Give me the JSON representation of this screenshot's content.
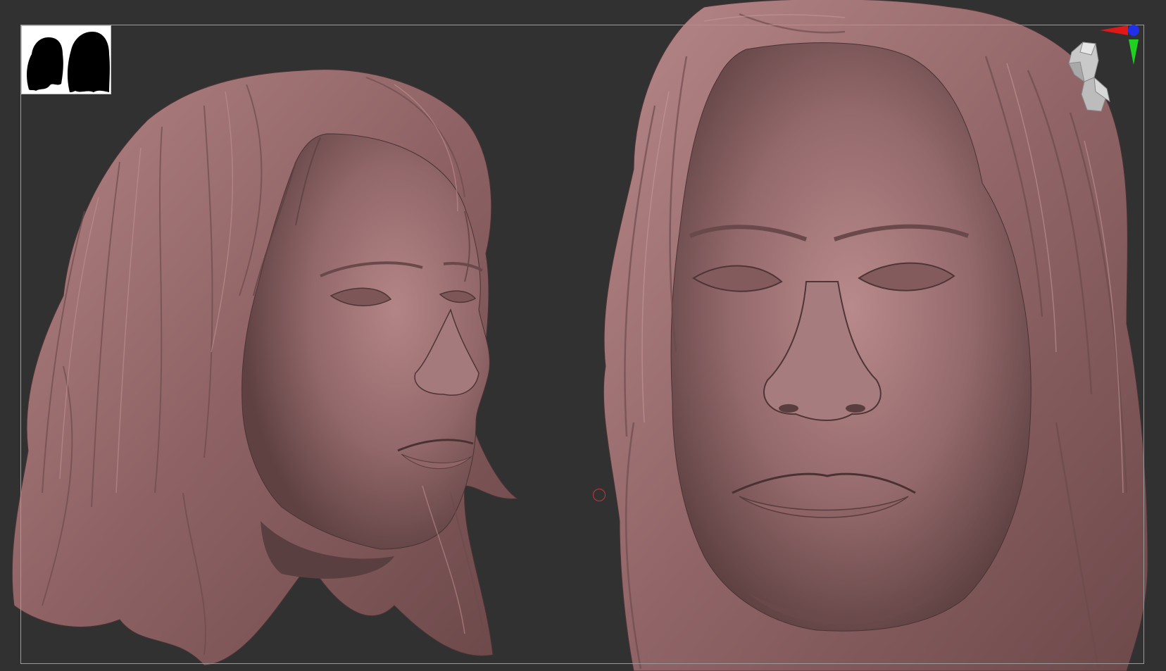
{
  "app": {
    "viewport_background": "#313131",
    "sculpt_material_color": "#a8787a",
    "frame_color": "#9a9a9a"
  },
  "icons": {
    "thumbnail": "silhouette-thumbnail-icon",
    "navigator": "head-navigator-icon",
    "axis_x": "axis-x-arrow-icon",
    "axis_y": "axis-y-arrow-icon",
    "axis_z": "axis-z-dot-icon",
    "pivot": "pivot-circle-icon"
  },
  "axis_colors": {
    "x": "#e01818",
    "y": "#1fd21f",
    "z": "#2030e8"
  }
}
